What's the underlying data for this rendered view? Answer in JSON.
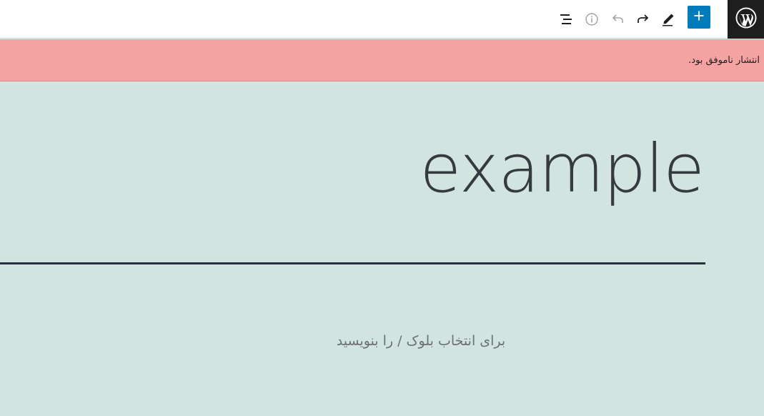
{
  "toolbar": {
    "icons": {
      "list_view": "list-view-icon",
      "details": "info-icon",
      "undo": "undo-icon",
      "redo": "redo-icon",
      "tools": "pencil-icon",
      "inserter": "plus-icon",
      "logo": "wordpress-logo"
    },
    "colors": {
      "inserter_bg": "#007cba",
      "logo_bg": "#1e1e1e",
      "disabled": "#a0a5aa",
      "enabled": "#1e1e1e"
    }
  },
  "notice": {
    "text": "انتشار ناموفق بود.",
    "background": "#f4a2a2"
  },
  "editor": {
    "title": "example",
    "placeholder": "برای انتخاب بلوک / را بنویسید",
    "background": "#d2e4df",
    "text_color": "#353a41"
  }
}
